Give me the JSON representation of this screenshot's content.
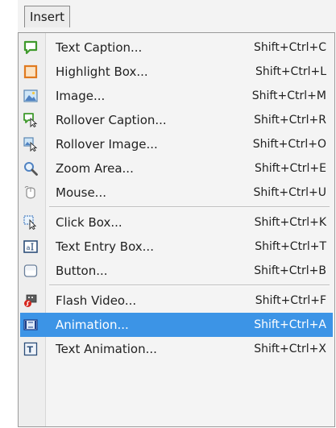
{
  "menubar": {
    "title": "Insert"
  },
  "menu": {
    "items": [
      {
        "label": "Text Caption...",
        "shortcut": "Shift+Ctrl+C",
        "icon": "text-caption-icon"
      },
      {
        "label": "Highlight Box...",
        "shortcut": "Shift+Ctrl+L",
        "icon": "highlight-box-icon"
      },
      {
        "label": "Image...",
        "shortcut": "Shift+Ctrl+M",
        "icon": "image-icon"
      },
      {
        "label": "Rollover Caption...",
        "shortcut": "Shift+Ctrl+R",
        "icon": "rollover-caption-icon"
      },
      {
        "label": "Rollover Image...",
        "shortcut": "Shift+Ctrl+O",
        "icon": "rollover-image-icon"
      },
      {
        "label": "Zoom Area...",
        "shortcut": "Shift+Ctrl+E",
        "icon": "zoom-area-icon"
      },
      {
        "label": "Mouse...",
        "shortcut": "Shift+Ctrl+U",
        "icon": "mouse-icon"
      },
      {
        "label": "Click Box...",
        "shortcut": "Shift+Ctrl+K",
        "icon": "click-box-icon"
      },
      {
        "label": "Text Entry Box...",
        "shortcut": "Shift+Ctrl+T",
        "icon": "text-entry-box-icon"
      },
      {
        "label": "Button...",
        "shortcut": "Shift+Ctrl+B",
        "icon": "button-icon"
      },
      {
        "label": "Flash Video...",
        "shortcut": "Shift+Ctrl+F",
        "icon": "flash-video-icon"
      },
      {
        "label": "Animation...",
        "shortcut": "Shift+Ctrl+A",
        "icon": "animation-icon",
        "selected": true
      },
      {
        "label": "Text Animation...",
        "shortcut": "Shift+Ctrl+X",
        "icon": "text-animation-icon"
      }
    ]
  },
  "colors": {
    "selection": "#3c94e6",
    "caption_green": "#3f9a2c",
    "highlight_orange": "#e07a1f",
    "panel": "#f4f4f4"
  }
}
